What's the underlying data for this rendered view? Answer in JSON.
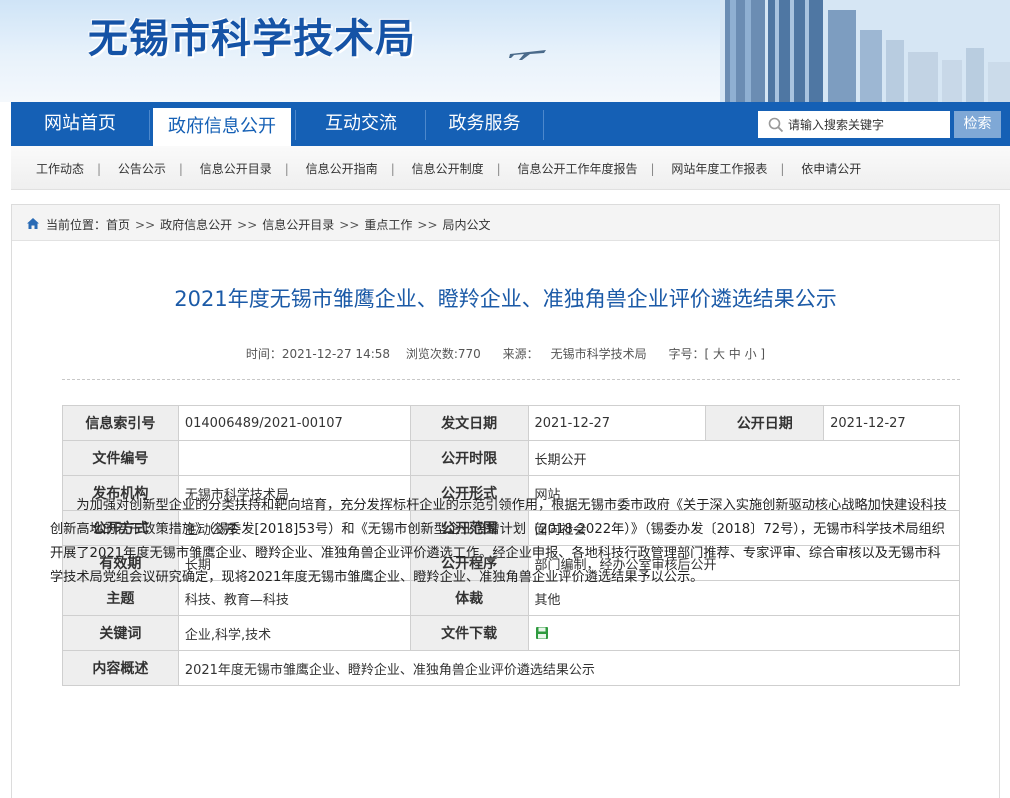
{
  "banner": {
    "site_title": "无锡市科学技术局"
  },
  "nav": {
    "items": [
      {
        "label": "网站首页",
        "active": false
      },
      {
        "label": "政府信息公开",
        "active": true
      },
      {
        "label": "互动交流",
        "active": false
      },
      {
        "label": "政务服务",
        "active": false
      }
    ],
    "search": {
      "placeholder": "请输入搜索关键字",
      "button": "检索"
    }
  },
  "subnav": {
    "items": [
      "工作动态",
      "公告公示",
      "信息公开目录",
      "信息公开指南",
      "信息公开制度",
      "信息公开工作年度报告",
      "网站年度工作报表",
      "依申请公开"
    ]
  },
  "breadcrumb": {
    "prefix": "当前位置：",
    "items": [
      "首页",
      "政府信息公开",
      "信息公开目录",
      "重点工作",
      "局内公文"
    ]
  },
  "article": {
    "title": "2021年度无锡市雏鹰企业、瞪羚企业、准独角兽企业评价遴选结果公示",
    "meta": {
      "time": "时间：2021-12-27 14:58",
      "views": "浏览次数:770",
      "source_label": "来源：",
      "source": "无锡市科学技术局",
      "fontsize": "字号：[ 大 中 小 ]"
    }
  },
  "info_table": {
    "index_label": "信息索引号",
    "index_value": "014006489/2021-00107",
    "issue_date_label": "发文日期",
    "issue_date_value": "2021-12-27",
    "open_date_label": "公开日期",
    "open_date_value": "2021-12-27",
    "doc_no_label": "文件编号",
    "doc_no_value": "",
    "open_time_label": "公开时限",
    "open_time_value": "长期公开",
    "publisher_label": "发布机构",
    "publisher_value": "无锡市科学技术局",
    "open_form_label": "公开形式",
    "open_form_value": "网站",
    "open_mode_label": "公开方式",
    "open_mode_value": "主动公开",
    "open_scope_label": "公开范围",
    "open_scope_value": "面向社会",
    "validity_label": "有效期",
    "validity_value": "长期",
    "procedure_label": "公开程序",
    "procedure_value": "部门编制，经办公室审核后公开",
    "subject_label": "主题",
    "subject_value": "科技、教育—科技",
    "genre_label": "体裁",
    "genre_value": "其他",
    "keywords_label": "关键词",
    "keywords_value": "企业,科学,技术",
    "download_label": "文件下载",
    "summary_label": "内容概述",
    "summary_value": "2021年度无锡市雏鹰企业、瞪羚企业、准独角兽企业评价遴选结果公示"
  },
  "body": {
    "paragraph": "为加强对创新型企业的分类扶持和靶向培育，充分发挥标杆企业的示范引领作用，根据无锡市委市政府《关于深入实施创新驱动核心战略加快建设科技创新高地的若干政策措施》（锡委发[2018]53号）和《无锡市创新型企业倍增计划（2018-2022年）》（锡委办发〔2018〕72号），无锡市科学技术局组织开展了2021年度无锡市雏鹰企业、瞪羚企业、准独角兽企业评价遴选工作。经企业申报、各地科技行政管理部门推荐、专家评审、综合审核以及无锡市科学技术局党组会议研究确定，现将2021年度无锡市雏鹰企业、瞪羚企业、准独角兽企业评价遴选结果予以公示。"
  }
}
